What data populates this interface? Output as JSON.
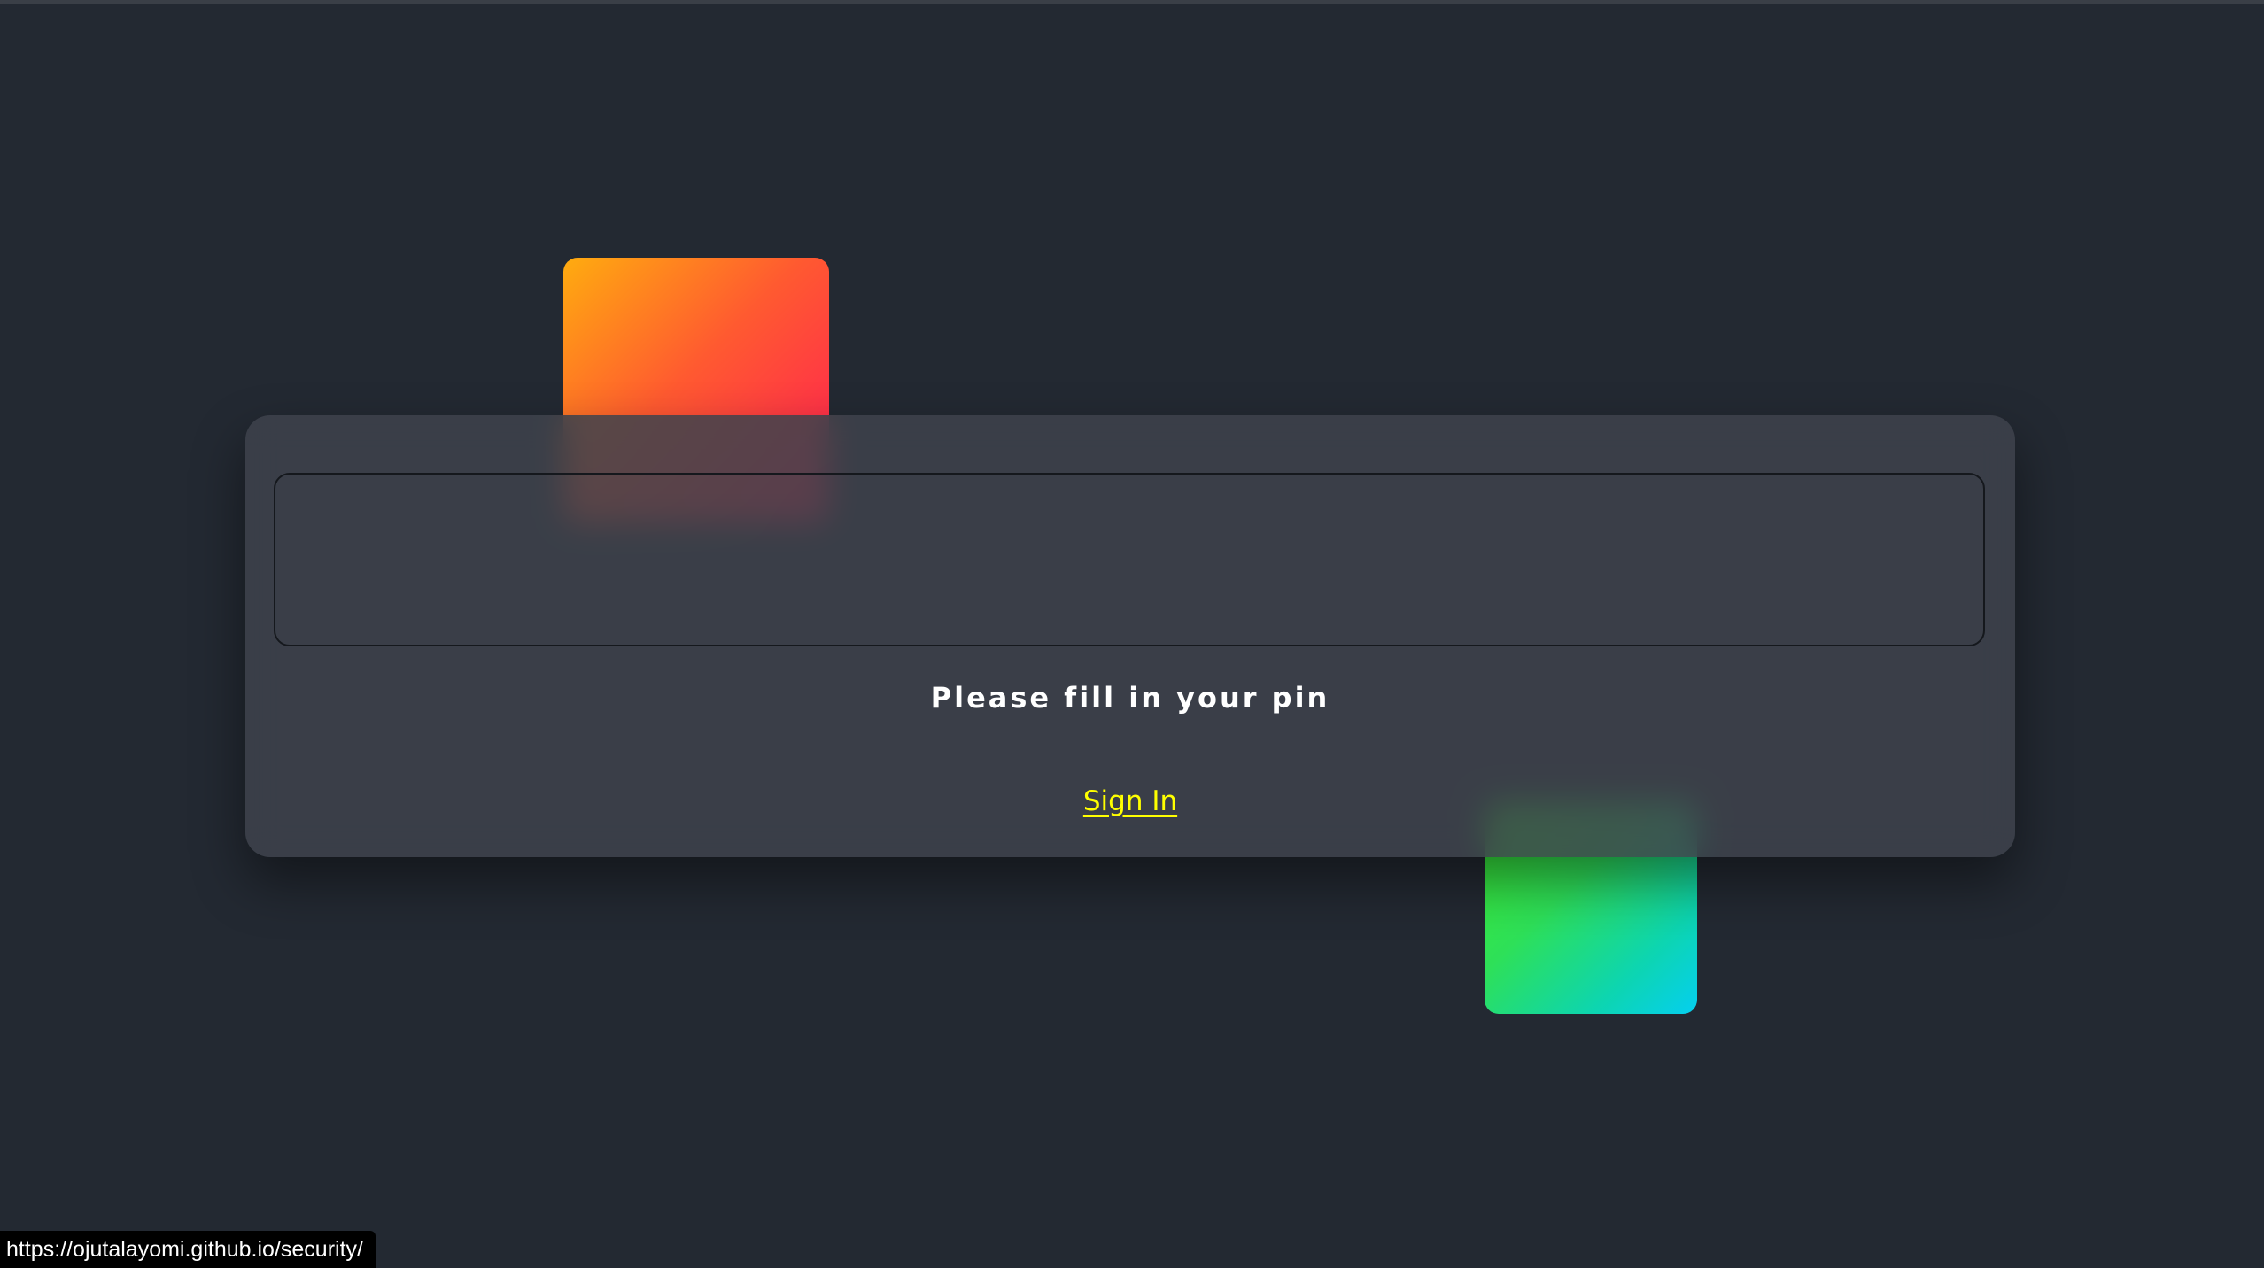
{
  "form": {
    "pin_value": "",
    "hint": "Please fill in your pin",
    "signin_label": "Sign In"
  },
  "status_bar": {
    "url": "https://ojutalayomi.github.io/security/"
  },
  "colors": {
    "background": "#232932",
    "card": "#3e424c",
    "link": "#ffff00",
    "orange_gradient": [
      "#ffac0f",
      "#ff5a30",
      "#ff1a55"
    ],
    "green_gradient": [
      "#3cef2f",
      "#0dd5b0",
      "#05cff0"
    ]
  }
}
